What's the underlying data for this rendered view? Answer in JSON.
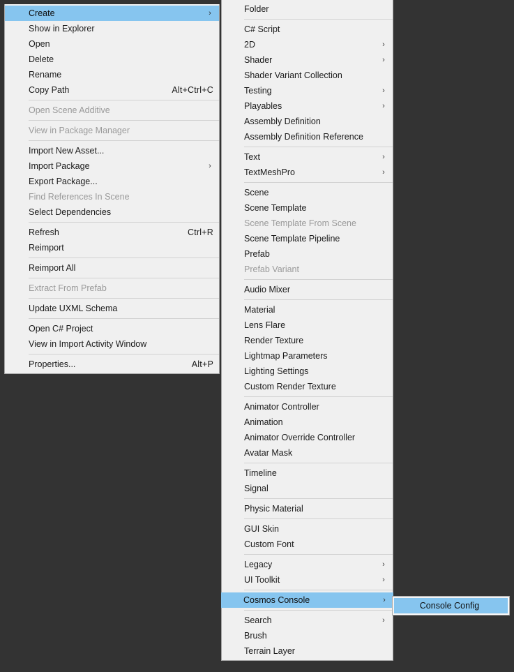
{
  "colors": {
    "desktop_background": "#333333",
    "menu_background": "#f0f0f0",
    "highlight": "#86c5ef",
    "text": "#1b1b1b",
    "text_disabled": "#9a9a9a",
    "separator": "#d2d2d2",
    "border": "#a5a5a5"
  },
  "icons": {
    "submenu_arrow": "›"
  },
  "menus": {
    "assets_context_menu": {
      "name": "Assets context menu",
      "items": [
        {
          "label": "Create",
          "type": "item",
          "submenu": true,
          "highlighted": true,
          "shortcut": ""
        },
        {
          "label": "Show in Explorer",
          "type": "item",
          "shortcut": ""
        },
        {
          "label": "Open",
          "type": "item",
          "shortcut": ""
        },
        {
          "label": "Delete",
          "type": "item",
          "shortcut": ""
        },
        {
          "label": "Rename",
          "type": "item",
          "shortcut": ""
        },
        {
          "label": "Copy Path",
          "type": "item",
          "shortcut": "Alt+Ctrl+C"
        },
        {
          "type": "separator"
        },
        {
          "label": "Open Scene Additive",
          "type": "item",
          "disabled": true,
          "shortcut": ""
        },
        {
          "type": "separator"
        },
        {
          "label": "View in Package Manager",
          "type": "item",
          "disabled": true,
          "shortcut": ""
        },
        {
          "type": "separator"
        },
        {
          "label": "Import New Asset...",
          "type": "item",
          "shortcut": ""
        },
        {
          "label": "Import Package",
          "type": "item",
          "submenu": true,
          "shortcut": ""
        },
        {
          "label": "Export Package...",
          "type": "item",
          "shortcut": ""
        },
        {
          "label": "Find References In Scene",
          "type": "item",
          "disabled": true,
          "shortcut": ""
        },
        {
          "label": "Select Dependencies",
          "type": "item",
          "shortcut": ""
        },
        {
          "type": "separator"
        },
        {
          "label": "Refresh",
          "type": "item",
          "shortcut": "Ctrl+R"
        },
        {
          "label": "Reimport",
          "type": "item",
          "shortcut": ""
        },
        {
          "type": "separator"
        },
        {
          "label": "Reimport All",
          "type": "item",
          "shortcut": ""
        },
        {
          "type": "separator"
        },
        {
          "label": "Extract From Prefab",
          "type": "item",
          "disabled": true,
          "shortcut": ""
        },
        {
          "type": "separator"
        },
        {
          "label": "Update UXML Schema",
          "type": "item",
          "shortcut": ""
        },
        {
          "type": "separator"
        },
        {
          "label": "Open C# Project",
          "type": "item",
          "shortcut": ""
        },
        {
          "label": "View in Import Activity Window",
          "type": "item",
          "shortcut": ""
        },
        {
          "type": "separator"
        },
        {
          "label": "Properties...",
          "type": "item",
          "shortcut": "Alt+P"
        }
      ]
    },
    "create_submenu": {
      "name": "Create submenu",
      "items": [
        {
          "label": "Folder",
          "type": "item"
        },
        {
          "type": "separator"
        },
        {
          "label": "C# Script",
          "type": "item"
        },
        {
          "label": "2D",
          "type": "item",
          "submenu": true
        },
        {
          "label": "Shader",
          "type": "item",
          "submenu": true
        },
        {
          "label": "Shader Variant Collection",
          "type": "item"
        },
        {
          "label": "Testing",
          "type": "item",
          "submenu": true
        },
        {
          "label": "Playables",
          "type": "item",
          "submenu": true
        },
        {
          "label": "Assembly Definition",
          "type": "item"
        },
        {
          "label": "Assembly Definition Reference",
          "type": "item"
        },
        {
          "type": "separator"
        },
        {
          "label": "Text",
          "type": "item",
          "submenu": true
        },
        {
          "label": "TextMeshPro",
          "type": "item",
          "submenu": true
        },
        {
          "type": "separator"
        },
        {
          "label": "Scene",
          "type": "item"
        },
        {
          "label": "Scene Template",
          "type": "item"
        },
        {
          "label": "Scene Template From Scene",
          "type": "item",
          "disabled": true
        },
        {
          "label": "Scene Template Pipeline",
          "type": "item"
        },
        {
          "label": "Prefab",
          "type": "item"
        },
        {
          "label": "Prefab Variant",
          "type": "item",
          "disabled": true
        },
        {
          "type": "separator"
        },
        {
          "label": "Audio Mixer",
          "type": "item"
        },
        {
          "type": "separator"
        },
        {
          "label": "Material",
          "type": "item"
        },
        {
          "label": "Lens Flare",
          "type": "item"
        },
        {
          "label": "Render Texture",
          "type": "item"
        },
        {
          "label": "Lightmap Parameters",
          "type": "item"
        },
        {
          "label": "Lighting Settings",
          "type": "item"
        },
        {
          "label": "Custom Render Texture",
          "type": "item"
        },
        {
          "type": "separator"
        },
        {
          "label": "Animator Controller",
          "type": "item"
        },
        {
          "label": "Animation",
          "type": "item"
        },
        {
          "label": "Animator Override Controller",
          "type": "item"
        },
        {
          "label": "Avatar Mask",
          "type": "item"
        },
        {
          "type": "separator"
        },
        {
          "label": "Timeline",
          "type": "item"
        },
        {
          "label": "Signal",
          "type": "item"
        },
        {
          "type": "separator"
        },
        {
          "label": "Physic Material",
          "type": "item"
        },
        {
          "type": "separator"
        },
        {
          "label": "GUI Skin",
          "type": "item"
        },
        {
          "label": "Custom Font",
          "type": "item"
        },
        {
          "type": "separator"
        },
        {
          "label": "Legacy",
          "type": "item",
          "submenu": true
        },
        {
          "label": "UI Toolkit",
          "type": "item",
          "submenu": true
        },
        {
          "type": "separator"
        },
        {
          "label": "Cosmos Console",
          "type": "item",
          "submenu": true,
          "highlighted": true,
          "full_bleed": true
        },
        {
          "type": "separator"
        },
        {
          "label": "Search",
          "type": "item",
          "submenu": true
        },
        {
          "label": "Brush",
          "type": "item"
        },
        {
          "label": "Terrain Layer",
          "type": "item"
        }
      ]
    },
    "cosmos_console_submenu": {
      "name": "Cosmos Console submenu",
      "items": [
        {
          "label": "Console Config",
          "type": "item",
          "highlighted": true
        }
      ]
    }
  }
}
